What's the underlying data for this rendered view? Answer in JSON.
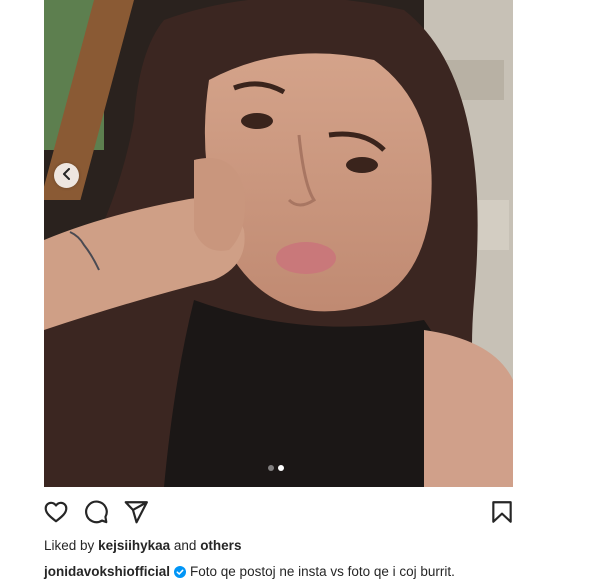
{
  "post": {
    "image_alt": "Selfie of a woman with long dark hair resting her cheek on her fist",
    "carousel": {
      "slide_count": 2,
      "active_index": 1
    }
  },
  "icons": {
    "like": "heart-icon",
    "comment": "comment-icon",
    "share": "send-icon",
    "save": "bookmark-icon",
    "prev": "chevron-left-icon",
    "verified": "verified-badge-icon"
  },
  "likes": {
    "prefix": "Liked by",
    "user": "kejsiihykaa",
    "conjunction": "and",
    "others": "others"
  },
  "caption": {
    "username": "jonidavokshiofficial",
    "text": "Foto qe postoj ne insta vs foto qe i coj burrit."
  },
  "colors": {
    "text": "#262626",
    "verified": "#0095f6"
  }
}
